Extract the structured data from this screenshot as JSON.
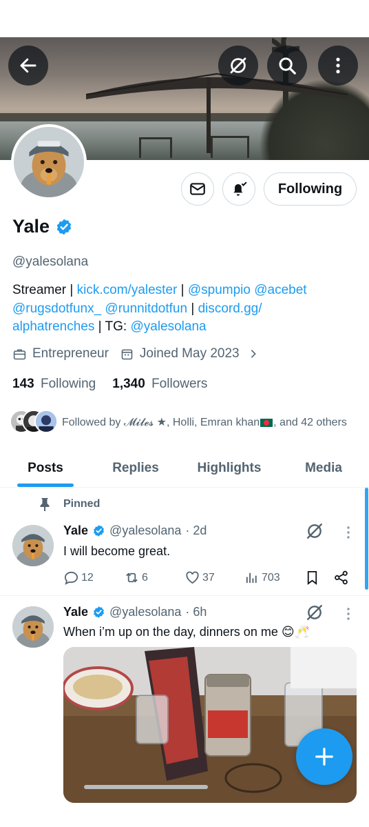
{
  "profile": {
    "name": "Yale",
    "handle": "@yalesolana",
    "bio": {
      "prefix": "Streamer | ",
      "link1": "kick.com/yalester",
      "sep1": " | ",
      "link2": "@spumpio",
      "sp1": " ",
      "link3": "@acebet",
      "sp2": " ",
      "link4": "@rugsdotfunx_",
      "sp3": " ",
      "link5": "@runnitdotfun",
      "sep2": " | ",
      "link6": "discord.gg/",
      "link6b": "alphatrenches",
      "tg": " | TG: ",
      "link7": "@yalesolana"
    },
    "category": "Entrepreneur",
    "joined": "Joined May 2023",
    "following_count": "143",
    "following_label": "Following",
    "followers_count": "1,340",
    "followers_label": "Followers",
    "followed_by_prefix": "Followed by ",
    "followed_by_name1": "𝓜𝓲𝓵𝓮𝓼 ★",
    "followed_by_rest1": ", Holli, Emran khan",
    "followed_by_rest2": ", and 42 others",
    "follow_button": "Following"
  },
  "header_icons": [
    "back-arrow-icon",
    "grok-icon",
    "search-icon",
    "more-vertical-icon"
  ],
  "tabs": [
    {
      "label": "Posts",
      "active": true
    },
    {
      "label": "Replies",
      "active": false
    },
    {
      "label": "Highlights",
      "active": false
    },
    {
      "label": "Media",
      "active": false
    }
  ],
  "posts": [
    {
      "pinned_label": "Pinned",
      "name": "Yale",
      "handle": "@yalesolana",
      "time": "· 2d",
      "text": "I will become great.",
      "replies": "12",
      "reposts": "6",
      "likes": "37",
      "views": "703"
    },
    {
      "name": "Yale",
      "handle": "@yalesolana",
      "time": "· 6h",
      "text": "When i’m up on the day, dinners on me 😊🥂"
    }
  ],
  "colors": {
    "accent": "#1d9bf0",
    "text_primary": "#0f1419",
    "text_secondary": "#536471",
    "border": "#cfd9de"
  }
}
